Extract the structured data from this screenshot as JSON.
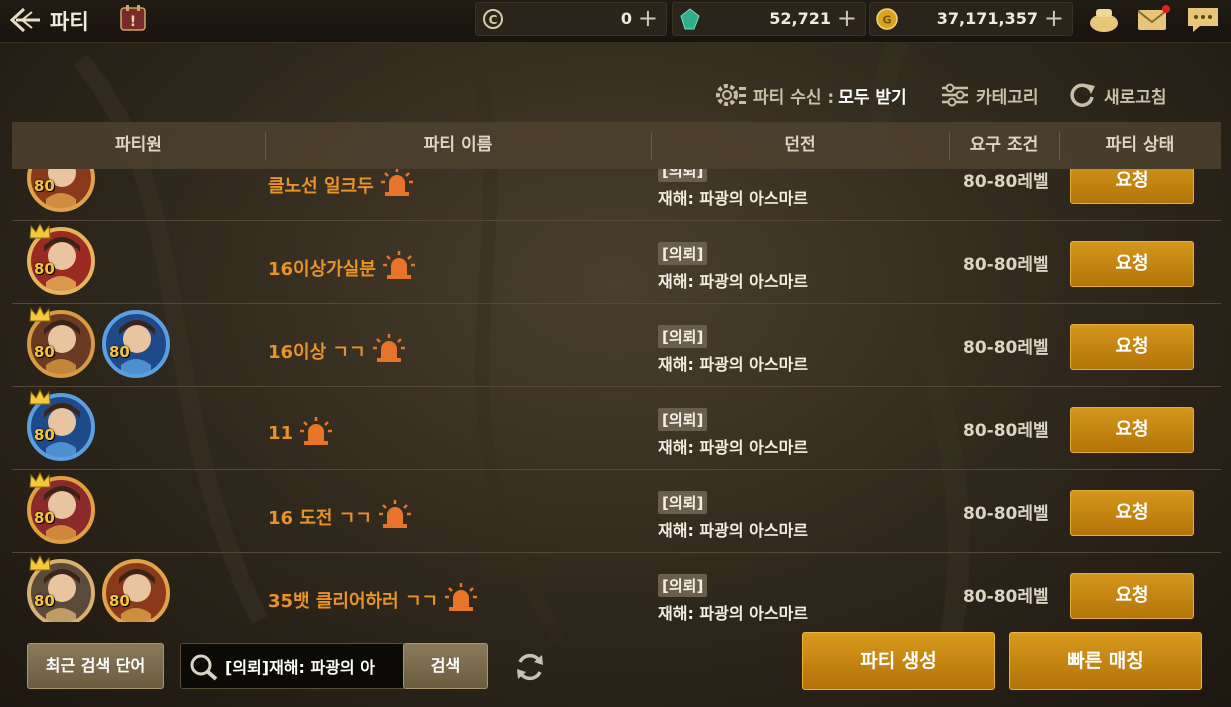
{
  "header": {
    "title": "파티",
    "currencies": [
      {
        "name": "coin-c",
        "value": "0"
      },
      {
        "name": "gem",
        "value": "52,721"
      },
      {
        "name": "gold",
        "value": "37,171,357"
      }
    ]
  },
  "toolbar": {
    "receive_label": "파티 수신 :",
    "receive_value": "모두 받기",
    "category_label": "카테고리",
    "refresh_label": "새로고침"
  },
  "table": {
    "headers": [
      "파티원",
      "파티 이름",
      "던전",
      "요구 조건",
      "파티 상태"
    ],
    "rows": [
      {
        "name": "클노선 일크두",
        "tag": "[의뢰]",
        "dungeon": "재해: 파광의 아스마르",
        "requirement": "80-80레벨",
        "action": "요청",
        "members": [
          {
            "level": "80",
            "leader": false
          }
        ]
      },
      {
        "name": "16이상가실분",
        "tag": "[의뢰]",
        "dungeon": "재해: 파광의 아스마르",
        "requirement": "80-80레벨",
        "action": "요청",
        "members": [
          {
            "level": "80",
            "leader": true
          }
        ]
      },
      {
        "name": "16이상 ㄱㄱ",
        "tag": "[의뢰]",
        "dungeon": "재해: 파광의 아스마르",
        "requirement": "80-80레벨",
        "action": "요청",
        "members": [
          {
            "level": "80",
            "leader": true
          },
          {
            "level": "80",
            "leader": false
          }
        ]
      },
      {
        "name": "11",
        "tag": "[의뢰]",
        "dungeon": "재해: 파광의 아스마르",
        "requirement": "80-80레벨",
        "action": "요청",
        "members": [
          {
            "level": "80",
            "leader": true
          }
        ]
      },
      {
        "name": "16 도전 ㄱㄱ",
        "tag": "[의뢰]",
        "dungeon": "재해: 파광의 아스마르",
        "requirement": "80-80레벨",
        "action": "요청",
        "members": [
          {
            "level": "80",
            "leader": true
          }
        ]
      },
      {
        "name": "35뱃 클리어하러 ㄱㄱ",
        "tag": "[의뢰]",
        "dungeon": "재해: 파광의 아스마르",
        "requirement": "80-80레벨",
        "action": "요청",
        "members": [
          {
            "level": "80",
            "leader": true
          },
          {
            "level": "80",
            "leader": false
          }
        ]
      }
    ]
  },
  "bottom": {
    "recent_label": "최근 검색 단어",
    "search_value": "[의뢰]재해: 파광의 아",
    "search_label": "검색",
    "create_label": "파티 생성",
    "quick_label": "빠른 매칭"
  },
  "colors": {
    "accent_gold": "#c58512",
    "party_name": "#e8922a",
    "level": "#f6c43a"
  }
}
